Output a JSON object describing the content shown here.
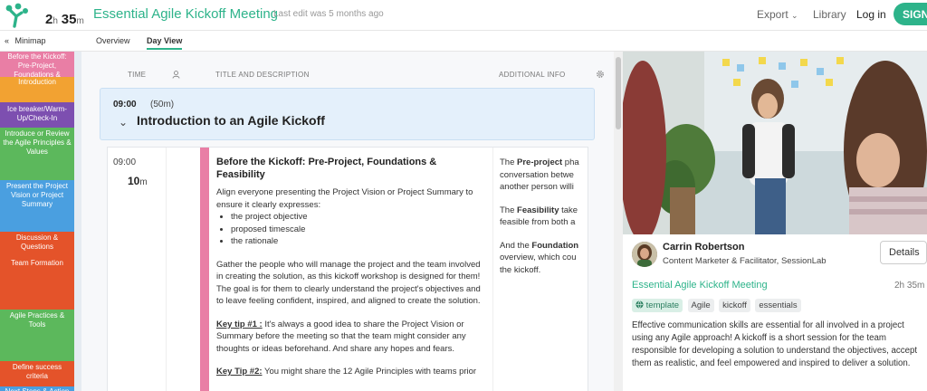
{
  "header": {
    "duration_hours": "2",
    "duration_h_unit": "h",
    "duration_minutes": "35",
    "duration_m_unit": "m",
    "title": "Essential Agile Kickoff Meeting",
    "last_edit": "Last edit was 5 months ago",
    "export_label": "Export",
    "library_label": "Library",
    "login_label": "Log in",
    "signup_label": "SIGN",
    "accent_color": "#2db38a"
  },
  "tabs": {
    "minimap_label": "Minimap",
    "overview_label": "Overview",
    "dayview_label": "Day View",
    "active": "Day View"
  },
  "minimap": [
    {
      "label": "Before the Kickoff: Pre-Project, Foundations & Feasibility",
      "color": "#e97ea5"
    },
    {
      "label": "Introduction",
      "color": "#f2a232"
    },
    {
      "label": "Ice breaker/Warm-Up/Check-In",
      "color": "#7d4fb0"
    },
    {
      "label": "Introduce or Review the Agile Principles & Values",
      "color": "#5cb85c"
    },
    {
      "label": "Present the Project Vision or Project Summary",
      "color": "#4a9fe0"
    },
    {
      "label": "Discussion & Questions",
      "color": "#e4532a"
    },
    {
      "label": "Team Formation",
      "color": "#e4532a"
    },
    {
      "label": "Agile Practices & Tools",
      "color": "#5cb85c"
    },
    {
      "label": "Define success criteria",
      "color": "#e4532a"
    },
    {
      "label": "Next Steps & Action Items",
      "color": "#4a9fe0"
    }
  ],
  "columns": {
    "time": "TIME",
    "title": "TITLE AND DESCRIPTION",
    "additional": "ADDITIONAL INFO"
  },
  "section": {
    "time": "09:00",
    "duration": "(50m)",
    "title": "Introduction to an Agile Kickoff"
  },
  "block": {
    "time": "09:00",
    "duration_value": "10",
    "duration_unit": "m",
    "title": "Before the Kickoff: Pre-Project, Foundations & Feasibility",
    "intro": "Align everyone presenting the Project Vision or Project Summary to ensure it clearly expresses:",
    "bullets": [
      "the project objective",
      "proposed timescale",
      "the rationale"
    ],
    "para2": "Gather the people who will manage the project and the team involved in creating the solution, as this kickoff workshop is designed for them! The goal is for them to clearly understand the project's objectives and to leave feeling confident, inspired, and aligned to create the solution.",
    "tip1_label": "Key tip #1 :",
    "tip1_text": " It's always a good idea to share the Project Vision or Summary before the meeting so that the team might consider any thoughts or ideas beforehand. And share any hopes and fears.",
    "tip2_label": "Key Tip #2:",
    "tip2_text": " You might share the 12 Agile Principles with teams prior"
  },
  "additional": {
    "p1_pre": "The ",
    "p1_bold": "Pre-project",
    "p1_post": " pha",
    "p1_l2": "conversation betwe",
    "p1_l3": "another person willi",
    "p2_pre": "The ",
    "p2_bold": "Feasibility",
    "p2_post": " take",
    "p2_l2": "feasible from both a",
    "p3_pre": "And the ",
    "p3_bold": "Foundation",
    "p3_post": "",
    "p3_l2": "overview, which cou",
    "p3_l3": "the kickoff."
  },
  "sidebar": {
    "author_name": "Carrin Robertson",
    "author_role": "Content Marketer & Facilitator, SessionLab",
    "details_label": "Details",
    "session_title": "Essential Agile Kickoff Meeting",
    "session_duration": "2h 35m",
    "tags": [
      "template",
      "Agile",
      "kickoff",
      "essentials"
    ],
    "description": "Effective communication skills are essential for all involved in a project using any Agile approach! A kickoff is a short session for the team responsible for developing a solution to understand the objectives, accept them as realistic, and feel empowered and inspired to deliver a solution."
  }
}
